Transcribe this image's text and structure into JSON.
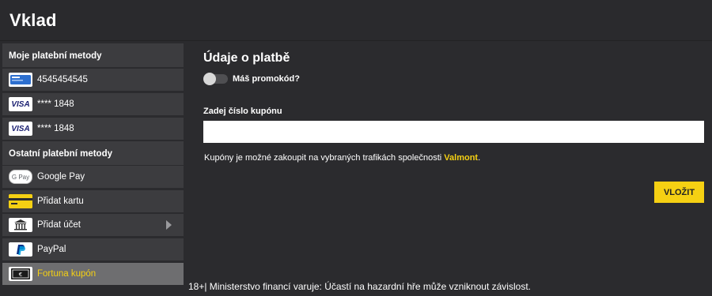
{
  "page": {
    "title": "Vklad"
  },
  "sidebar": {
    "my_methods_header": "Moje platební metody",
    "my_methods": [
      {
        "label": "4545454545",
        "icon": "card-bank-icon"
      },
      {
        "label": "**** 1848",
        "icon": "visa-icon"
      },
      {
        "label": "**** 1848",
        "icon": "visa-icon"
      }
    ],
    "other_methods_header": "Ostatní platební metody",
    "other_methods": [
      {
        "label": "Google Pay",
        "icon": "google-pay-icon"
      },
      {
        "label": "Přidat kartu",
        "icon": "credit-card-icon"
      },
      {
        "label": "Přidat účet",
        "icon": "bank-icon"
      },
      {
        "label": "PayPal",
        "icon": "paypal-icon"
      },
      {
        "label": "Fortuna kupón",
        "icon": "coupon-icon",
        "selected": true
      }
    ],
    "visa_text": "VISA",
    "gpay_text": "G Pay"
  },
  "main": {
    "heading": "Údaje o platbě",
    "promo_label": "Máš promokód?",
    "promo_enabled": false,
    "coupon_label": "Zadej číslo kupónu",
    "coupon_value": "",
    "info_text": "Kupóny je možné zakoupit na vybraných trafikách společnosti",
    "info_brand": "Valmont",
    "info_end": ".",
    "submit_label": "VLOŽIT"
  },
  "footer": {
    "warning": "18+| Ministerstvo financí varuje: Účastí na hazardní hře může vzniknout závislost."
  },
  "colors": {
    "accent": "#f5d013",
    "background": "#2b2b2e",
    "panel": "#3c3c3f",
    "selected": "#6e6e70"
  }
}
